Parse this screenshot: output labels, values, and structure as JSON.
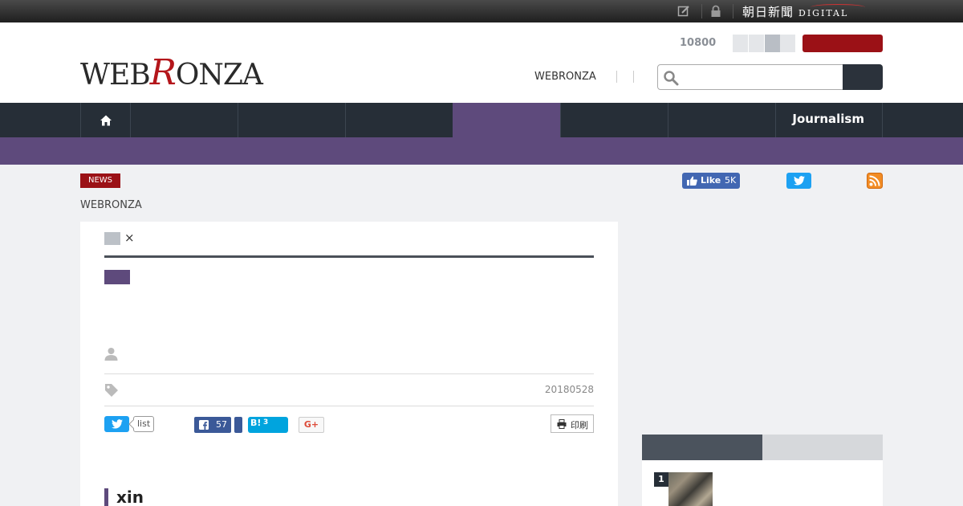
{
  "topbar": {
    "brand_name": "朝日新聞",
    "brand_sub": "DIGITAL",
    "icons": [
      "edit-icon",
      "lock-icon"
    ]
  },
  "header": {
    "logo_left": "WEB",
    "logo_r": "R",
    "logo_right": "ONZA",
    "count": "10800",
    "link": "WEBRONZA",
    "search": {
      "placeholder": "",
      "value": ""
    }
  },
  "nav": {
    "items": [
      {
        "icon": "home-icon"
      },
      {
        "label": ""
      },
      {
        "label": ""
      },
      {
        "label": ""
      },
      {
        "label": "",
        "active": true
      },
      {
        "label": ""
      },
      {
        "label": ""
      },
      {
        "label": "Journalism"
      }
    ]
  },
  "page": {
    "badge": "NEWS",
    "breadcrumb": "WEBRONZA",
    "social": {
      "like_label": "Like",
      "like_count": "5K"
    }
  },
  "article": {
    "close_symbol": "×",
    "date": "20180528",
    "share": {
      "tweet_count_label": "list",
      "facebook_count": "57",
      "hatena_label": "B!",
      "hatena_count": "3",
      "gplus_label": "G+",
      "print_label": "印刷"
    },
    "section_heading": "xin"
  },
  "sidebar": {
    "ranking": [
      {
        "rank": "1"
      }
    ]
  },
  "colors": {
    "brand_red": "#9b1116",
    "nav_dark": "#262e37",
    "accent_purple": "#5e4a7c",
    "twitter_blue": "#1da1f2",
    "facebook_blue": "#3b5998",
    "hatena_blue": "#00a4de"
  }
}
